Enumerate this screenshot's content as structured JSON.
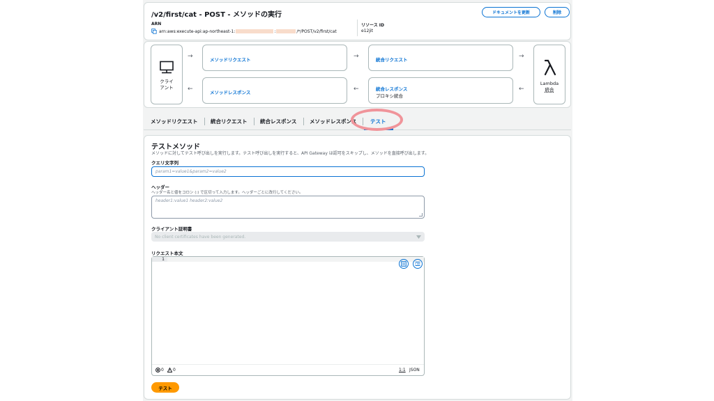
{
  "header": {
    "title": "/v2/first/cat - POST - メソッドの実行",
    "docs_button": "ドキュメントを更新",
    "delete_button": "削除",
    "arn_label": "ARN",
    "arn_prefix": "arn:aws:execute-api:ap-northeast-1:",
    "arn_mid": ":",
    "arn_suffix": "/*/POST/v2/first/cat",
    "resource_id_label": "リソース ID",
    "resource_id_value": "e12jit"
  },
  "flow": {
    "client_label_1": "クライ",
    "client_label_2": "アント",
    "method_request": "メソッドリクエスト",
    "integration_request": "統合リクエスト",
    "method_response": "メソッドレスポンス",
    "integration_response": "統合レスポンス",
    "integration_response_sub": "プロキシ統合",
    "lambda_label_1": "Lambda",
    "lambda_label_2": "統合",
    "arrow_right": "→",
    "arrow_left": "←"
  },
  "tabs": [
    {
      "label": "メソッドリクエスト",
      "active": false
    },
    {
      "label": "統合リクエスト",
      "active": false
    },
    {
      "label": "統合レスポンス",
      "active": false
    },
    {
      "label": "メソッドレスポンス",
      "active": false
    },
    {
      "label": "テスト",
      "active": true
    }
  ],
  "test": {
    "title": "テストメソッド",
    "description": "メソッドに対してテスト呼び出しを実行します。テスト呼び出しを実行すると、API Gateway は認可をスキップし、メソッドを直接呼び出します。",
    "query_label": "クエリ文字列",
    "query_placeholder": "param1=value1&param2=value2",
    "headers_label": "ヘッダー",
    "headers_desc": "ヘッダー名と値をコロン (:) で区切って入力します。ヘッダーごとに改行してください。",
    "headers_placeholder": "header1:value1 header2:value2",
    "cert_label": "クライアント証明書",
    "cert_placeholder": "No client certificates have been generated.",
    "body_label": "リクエスト本文",
    "line_number": "1",
    "errors_count": "0",
    "warnings_count": "0",
    "cursor_position": "1:1",
    "language": "JSON",
    "test_button": "テスト"
  }
}
